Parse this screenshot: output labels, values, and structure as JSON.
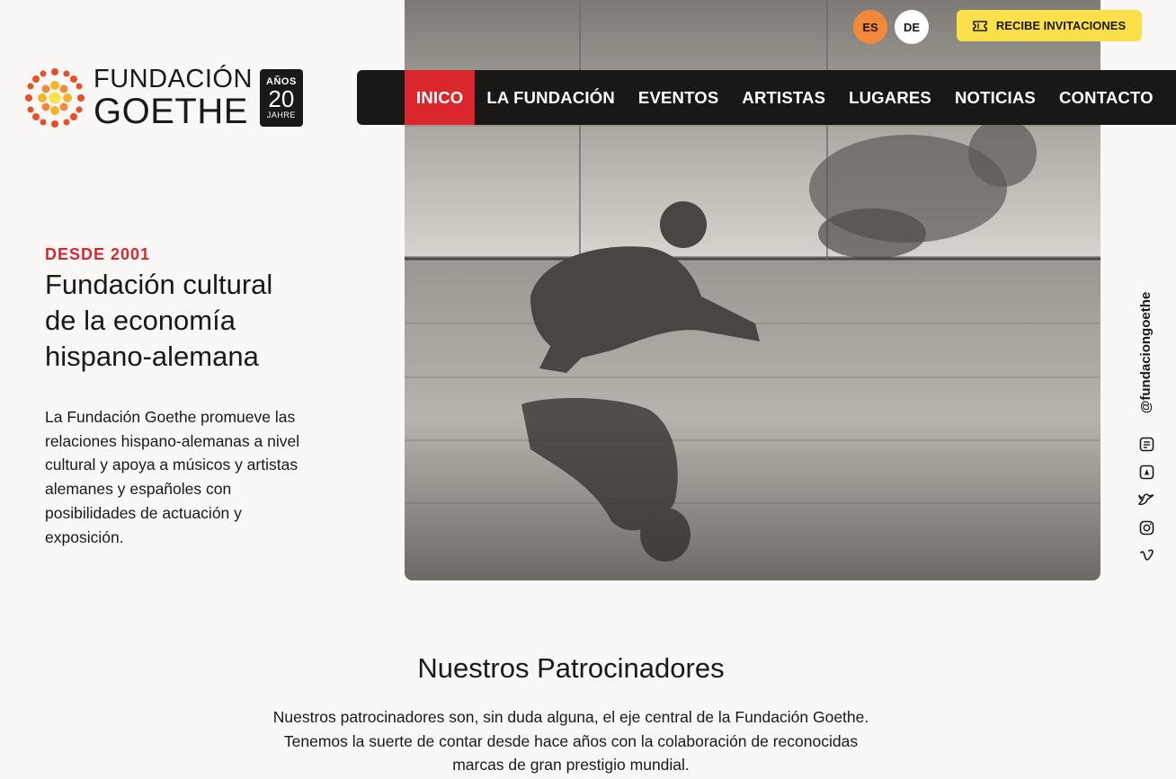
{
  "brand": {
    "line1": "FUNDACIÓN",
    "line2": "GOETHE",
    "badge_top": "AÑOS",
    "badge_num": "20",
    "badge_bottom": "JAHRE",
    "accent": "#d9272d",
    "dot_colors": [
      "#e94e24",
      "#f2883a",
      "#f7b32b",
      "#fbe04a"
    ]
  },
  "topbar": {
    "languages": [
      {
        "code": "ES",
        "active": true,
        "color": "#f2883a"
      },
      {
        "code": "DE",
        "active": false,
        "color": "#ffffff"
      }
    ],
    "invitations_label": "RECIBE INVITACIONES",
    "invitations_icon": "ticket-icon",
    "invitations_color": "#fbe04a"
  },
  "nav": {
    "items": [
      {
        "label": "INICO",
        "active": true
      },
      {
        "label": "LA FUNDACIÓN",
        "active": false
      },
      {
        "label": "EVENTOS",
        "active": false
      },
      {
        "label": "ARTISTAS",
        "active": false
      },
      {
        "label": "LUGARES",
        "active": false
      },
      {
        "label": "NOTICIAS",
        "active": false
      },
      {
        "label": "CONTACTO",
        "active": false
      }
    ],
    "background": "#1a1817",
    "active_color": "#d9272d"
  },
  "hero": {
    "eyebrow": "DESDE 2001",
    "headline_lines": [
      "Fundación cultural",
      "de la economía",
      "hispano-alemana"
    ],
    "intro_lines": [
      "La Fundación Goethe promueve las",
      "relaciones hispano-alemanas a nivel",
      "cultural y apoya a músicos y artistas",
      "alemanes y españoles con",
      "posibilidades de actuación y",
      "exposición."
    ]
  },
  "social": {
    "handle": "@fundaciongoethe",
    "icons": [
      "blog-icon",
      "tiktok-icon",
      "twitter-icon",
      "instagram-icon",
      "vimeo-icon"
    ]
  },
  "sponsors": {
    "title": "Nuestros Patrocinadores",
    "text_lines": [
      "Nuestros patrocinadores son, sin duda alguna, el eje central de la Fundación Goethe.",
      "Tenemos la suerte de contar desde hace años con la colaboración de reconocidas",
      "marcas de gran prestigio mundial."
    ]
  }
}
